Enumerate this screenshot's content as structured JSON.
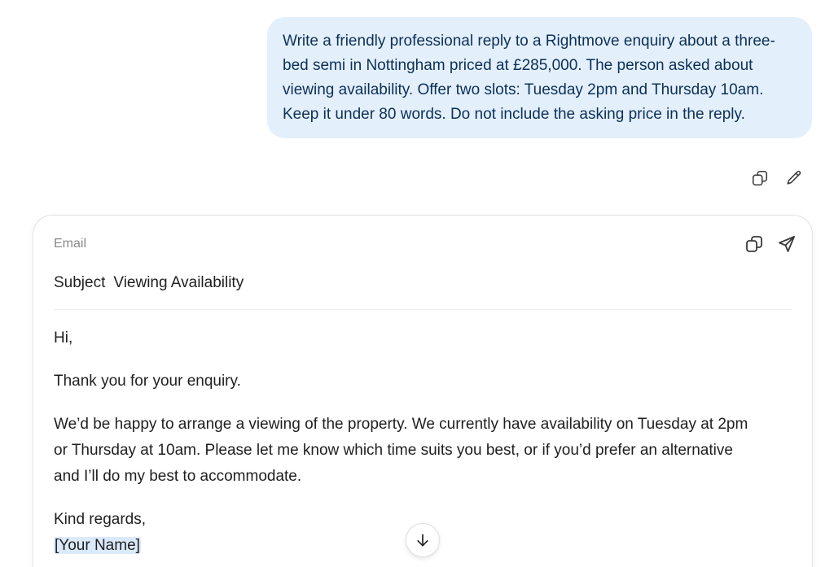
{
  "user_message": {
    "text": "Write a friendly professional reply to a Rightmove enquiry about a three-bed semi in Nottingham priced at £285,000. The person asked about viewing availability. Offer two slots: Tuesday 2pm and Thursday 10am. Keep it under 80 words. Do not include the asking price in the reply.",
    "actions": [
      {
        "icon": "copy-icon"
      },
      {
        "icon": "pencil-icon"
      }
    ]
  },
  "email": {
    "label": "Email",
    "subject_label": "Subject",
    "subject": "Viewing Availability",
    "greeting": "Hi,",
    "para1": "Thank you for your enquiry.",
    "para2": "We’d be happy to arrange a viewing of the property. We currently have availability on Tuesday at 2pm or Thursday at 10am. Please let me know which time suits you best, or if you’d prefer an alternative and I’ll do my best to accommodate.",
    "signoff": "Kind regards,",
    "signature": "[Your Name]",
    "actions": [
      {
        "icon": "copy-icon"
      },
      {
        "icon": "send-icon"
      }
    ]
  },
  "scroll_button": {
    "icon": "arrow-down-icon"
  },
  "colors": {
    "user_bubble_bg": "#e3f0fc",
    "user_bubble_text": "#0d2f57",
    "placeholder_highlight": "#dbeafb"
  }
}
